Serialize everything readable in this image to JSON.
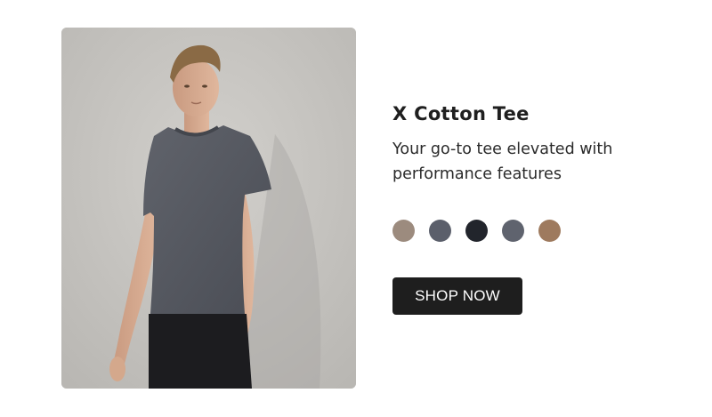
{
  "product": {
    "title": "X Cotton Tee",
    "description": "Your go-to tee elevated with performance features",
    "image_icon": "product-photo",
    "colors": [
      {
        "name": "taupe",
        "hex": "#9c8b7e"
      },
      {
        "name": "slate",
        "hex": "#5b5f6b"
      },
      {
        "name": "black",
        "hex": "#22252c"
      },
      {
        "name": "charcoal",
        "hex": "#5f636e"
      },
      {
        "name": "brown",
        "hex": "#9e7a5e"
      }
    ],
    "cta_label": "SHOP NOW"
  },
  "theme": {
    "button_bg": "#1e1e1e",
    "button_text": "#ffffff",
    "text_color": "#1f1f1f"
  }
}
